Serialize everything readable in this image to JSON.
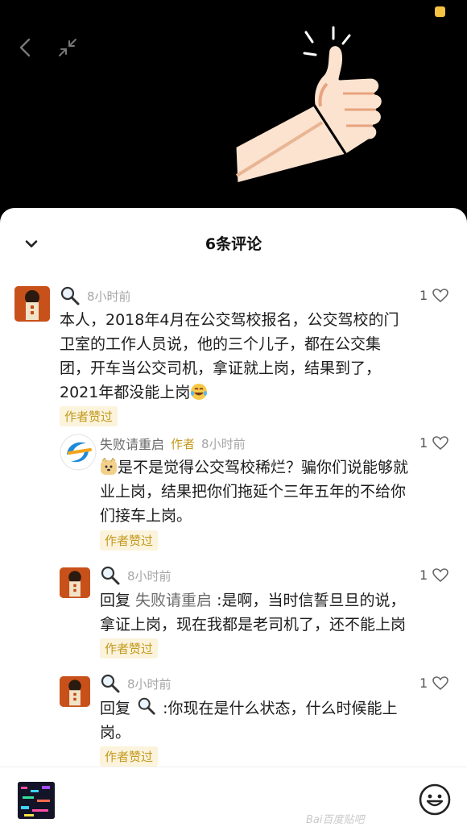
{
  "header": {
    "title": "6条评论"
  },
  "comments": [
    {
      "user": "",
      "time": "8小时前",
      "likes": "1",
      "text": "本人，2018年4月在公交驾校报名，公交驾校的门卫室的工作人员说，他的三个儿子，都在公交集团，开车当公交司机，拿证就上岗，结果到了，2021年都没能上岗",
      "line1": "本人，2018年4月在公交驾校报名，公交驾校的门",
      "line2": "卫室的工作人员说，他的三个儿子，都在公交集",
      "line3": "团，开车当公交司机，拿证就上岗，结果到了，",
      "line4": "2021年都没能上岗",
      "badge": "作者赞过"
    },
    {
      "user": "失败请重启",
      "author_tag": "作者",
      "time": "8小时前",
      "likes": "1",
      "line1": "是不是觉得公交驾校稀烂？骗你们说能够就",
      "line2": "业上岗，结果把你们拖延个三年五年的不给你",
      "line3": "们接车上岗。",
      "badge": "作者赞过"
    },
    {
      "time": "8小时前",
      "likes": "1",
      "reply_prefix": "回复 ",
      "reply_to": "失败请重启",
      "line1_rest": " :是啊，当时信誓旦旦的说，",
      "line2": "拿证上岗，现在我都是老司机了，还不能上岗",
      "badge": "作者赞过"
    },
    {
      "time": "8小时前",
      "likes": "1",
      "reply_prefix": "回复 ",
      "line1_rest": " :你现在是什么状态，什么时候能上",
      "line2": "岗。",
      "badge": "作者赞过"
    }
  ],
  "bottom": {
    "input_placeholder": "",
    "watermark": "Bai百度贴吧"
  },
  "colors": {
    "author_gold": "#c29a1e",
    "indicator": "#f5c242"
  },
  "icons": [
    "back-icon",
    "shrink-icon",
    "thumbs-up-illustration",
    "chevron-down-icon",
    "magnifier-avatar-icon",
    "heart-icon",
    "emoji-icon"
  ]
}
